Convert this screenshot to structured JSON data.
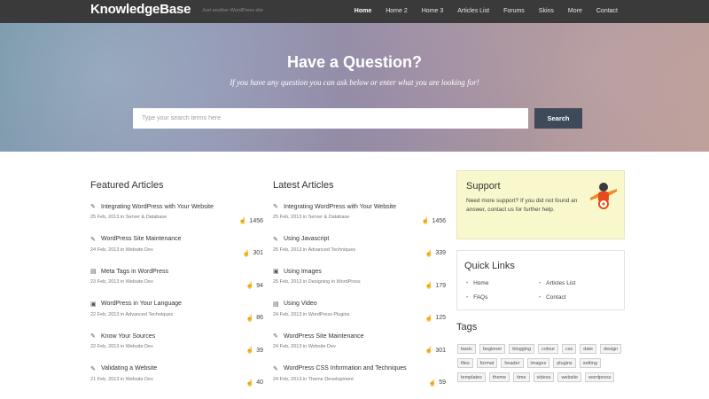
{
  "header": {
    "logo": "KnowledgeBase",
    "tagline": "Just another WordPress site",
    "nav": [
      "Home",
      "Home 2",
      "Home 3",
      "Articles List",
      "Forums",
      "Skins",
      "More",
      "Contact"
    ]
  },
  "hero": {
    "title": "Have a Question?",
    "subtitle": "If you have any question you can ask below or enter what you are looking for!",
    "search_placeholder": "Type your search terms here",
    "search_button": "Search"
  },
  "featured": {
    "title": "Featured Articles",
    "articles": [
      {
        "icon": "edit-icon",
        "title": "Integrating WordPress with Your Website",
        "date": "25 Feb, 2013",
        "category": "Server & Database",
        "likes": "1456"
      },
      {
        "icon": "edit-icon",
        "title": "WordPress Site Maintenance",
        "date": "24 Feb, 2013",
        "category": "Website Dev",
        "likes": "301"
      },
      {
        "icon": "video-icon",
        "title": "Meta Tags in WordPress",
        "date": "23 Feb, 2013",
        "category": "Website Dev",
        "likes": "94"
      },
      {
        "icon": "image-icon",
        "title": "WordPress in Your Language",
        "date": "22 Feb, 2013",
        "category": "Advanced Techniques",
        "likes": "86"
      },
      {
        "icon": "edit-icon",
        "title": "Know Your Sources",
        "date": "22 Feb, 2013",
        "category": "Website Dev",
        "likes": "39"
      },
      {
        "icon": "edit-icon",
        "title": "Validating a Website",
        "date": "21 Feb, 2013",
        "category": "Website Dev",
        "likes": "40"
      }
    ]
  },
  "latest": {
    "title": "Latest Articles",
    "articles": [
      {
        "icon": "edit-icon",
        "title": "Integrating WordPress with Your Website",
        "date": "25 Feb, 2013",
        "category": "Server & Database",
        "likes": "1456"
      },
      {
        "icon": "edit-icon",
        "title": "Using Javascript",
        "date": "25 Feb, 2013",
        "category": "Advanced Techniques",
        "likes": "339"
      },
      {
        "icon": "image-icon",
        "title": "Using Images",
        "date": "25 Feb, 2013",
        "category": "Designing in WordPress",
        "likes": "179"
      },
      {
        "icon": "video-icon",
        "title": "Using Video",
        "date": "24 Feb, 2013",
        "category": "WordPress Plugins",
        "likes": "125"
      },
      {
        "icon": "edit-icon",
        "title": "WordPress Site Maintenance",
        "date": "24 Feb, 2013",
        "category": "Website Dev",
        "likes": "301"
      },
      {
        "icon": "edit-icon",
        "title": "WordPress CSS Information and Techniques",
        "date": "24 Feb, 2013",
        "category": "Theme Development",
        "likes": "59"
      }
    ]
  },
  "meta_in": "in",
  "support": {
    "title": "Support",
    "text": "Need more support? If you did not found an answer, contact us for further help."
  },
  "quick_links": {
    "title": "Quick Links",
    "items": [
      "Home",
      "Articles List",
      "FAQs",
      "Contact"
    ]
  },
  "tags": {
    "title": "Tags",
    "items": [
      "basic",
      "beginner",
      "blogging",
      "colour",
      "css",
      "date",
      "design",
      "files",
      "format",
      "header",
      "images",
      "plugins",
      "setting",
      "templates",
      "theme",
      "time",
      "videos",
      "website",
      "wordpress"
    ]
  },
  "colors": {
    "header_bg": "#3a3a3a",
    "search_button_bg": "#3e4a59",
    "support_bg": "#f8f8cc"
  }
}
